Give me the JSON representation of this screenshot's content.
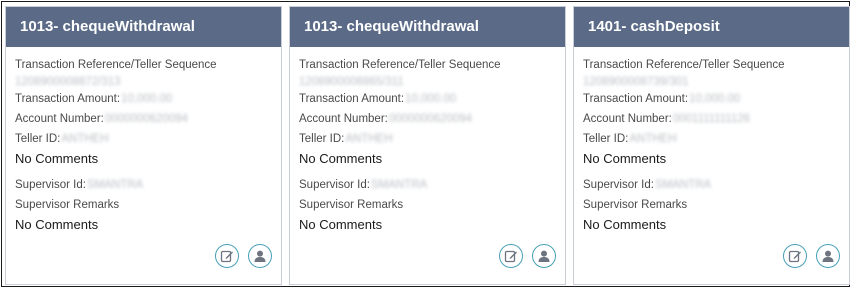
{
  "labels": {
    "ref": "Transaction Reference/Teller Sequence",
    "amount": "Transaction Amount:",
    "account": "Account Number:",
    "teller": "Teller ID:",
    "supervisor": "Supervisor Id:",
    "remarks": "Supervisor Remarks"
  },
  "cards": [
    {
      "title": "1013- chequeWithdrawal",
      "ref_value": "1208900008872/313",
      "amount_value": "10,000.00",
      "account_value": "0000000620094",
      "teller_value": "ANTHEH",
      "teller_comment": "No Comments",
      "supervisor_value": "SMANTRA",
      "remarks_value": "No Comments"
    },
    {
      "title": "1013- chequeWithdrawal",
      "ref_value": "1208900008865/311",
      "amount_value": "10,000.00",
      "account_value": "0000000620094",
      "teller_value": "ANTHEH",
      "teller_comment": "No Comments",
      "supervisor_value": "SMANTRA",
      "remarks_value": "No Comments"
    },
    {
      "title": "1401- cashDeposit",
      "ref_value": "1208900008739/301",
      "amount_value": "10,000.00",
      "account_value": "0001111111126",
      "teller_value": "ANTHEH",
      "teller_comment": "No Comments",
      "supervisor_value": "SMANTRA",
      "remarks_value": "No Comments"
    }
  ],
  "icons": {
    "edit": "edit-note-icon",
    "user": "user-icon"
  },
  "colors": {
    "header": "#5b6b87",
    "icon_accent": "#4aa0b8"
  }
}
